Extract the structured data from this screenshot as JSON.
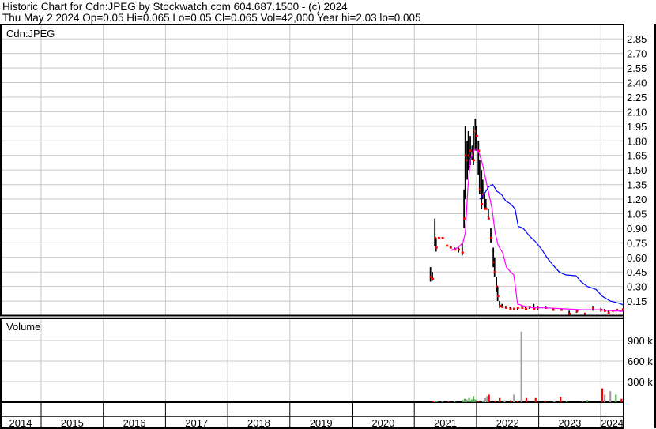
{
  "header": {
    "title": "Historic Chart for Cdn:JPEG by Stockwatch.com 604.687.1500 - (c) 2024",
    "quote": "Thu May  2 2024   Op=0.05   Hi=0.065   Lo=0.05   Cl=0.065   Vol=42,000   Year hi=2.03   lo=0.005"
  },
  "chart_data": [
    {
      "type": "line",
      "title": "Cdn:JPEG",
      "subtype": "ohlc-with-moving-averages",
      "ylim": [
        0,
        2.95
      ],
      "yticks": [
        "2.85",
        "2.70",
        "2.55",
        "2.40",
        "2.25",
        "2.10",
        "1.95",
        "1.80",
        "1.65",
        "1.50",
        "1.35",
        "1.20",
        "1.05",
        "0.90",
        "0.75",
        "0.60",
        "0.45",
        "0.30",
        "0.15"
      ],
      "xlim": [
        2014.34,
        2024.38
      ],
      "xtick_labels": [
        "2014",
        "2015",
        "2016",
        "2017",
        "2018",
        "2019",
        "2020",
        "2021",
        "2022",
        "2023",
        "2024"
      ],
      "colors": {
        "bar": "#000000",
        "close": "#ff0000",
        "ma_short": "#ff00ff",
        "ma_long": "#0000ff"
      },
      "bars_t_hi_lo_close": [
        [
          2021.26,
          0.5,
          0.35,
          0.4
        ],
        [
          2021.29,
          0.45,
          0.36,
          0.38
        ],
        [
          2021.33,
          1.0,
          0.72,
          0.8
        ],
        [
          2021.35,
          0.8,
          0.66,
          0.7
        ],
        [
          2021.39,
          0.8,
          0.8,
          0.8
        ],
        [
          2021.45,
          0.8,
          0.8,
          0.8
        ],
        [
          2021.52,
          0.73,
          0.72,
          0.72
        ],
        [
          2021.58,
          0.72,
          0.7,
          0.7
        ],
        [
          2021.65,
          0.7,
          0.68,
          0.68
        ],
        [
          2021.71,
          0.7,
          0.65,
          0.68
        ],
        [
          2021.77,
          0.75,
          0.62,
          0.65
        ],
        [
          2021.8,
          1.3,
          0.9,
          1.0
        ],
        [
          2021.82,
          1.95,
          1.2,
          1.65
        ],
        [
          2021.85,
          1.8,
          1.4,
          1.6
        ],
        [
          2021.87,
          1.9,
          1.5,
          1.65
        ],
        [
          2021.9,
          1.85,
          1.55,
          1.7
        ],
        [
          2021.93,
          1.75,
          1.6,
          1.65
        ],
        [
          2021.95,
          1.95,
          1.55,
          1.6
        ],
        [
          2021.98,
          2.03,
          1.7,
          1.9
        ],
        [
          2022.0,
          1.95,
          1.7,
          1.85
        ],
        [
          2022.03,
          1.8,
          1.45,
          1.7
        ],
        [
          2022.05,
          1.6,
          1.25,
          1.3
        ],
        [
          2022.08,
          1.5,
          1.1,
          1.15
        ],
        [
          2022.1,
          1.4,
          1.2,
          1.25
        ],
        [
          2022.13,
          1.25,
          1.1,
          1.1
        ],
        [
          2022.15,
          1.2,
          1.1,
          1.1
        ],
        [
          2022.19,
          1.1,
          1.0,
          1.0
        ],
        [
          2022.23,
          0.9,
          0.75,
          0.8
        ],
        [
          2022.27,
          0.7,
          0.5,
          0.55
        ],
        [
          2022.29,
          0.6,
          0.4,
          0.45
        ],
        [
          2022.32,
          0.4,
          0.25,
          0.3
        ],
        [
          2022.34,
          0.3,
          0.15,
          0.2
        ],
        [
          2022.37,
          0.15,
          0.08,
          0.1
        ],
        [
          2022.41,
          0.12,
          0.08,
          0.09
        ],
        [
          2022.47,
          0.1,
          0.07,
          0.08
        ],
        [
          2022.54,
          0.09,
          0.06,
          0.07
        ],
        [
          2022.6,
          0.08,
          0.06,
          0.07
        ],
        [
          2022.66,
          0.09,
          0.06,
          0.08
        ],
        [
          2022.73,
          0.1,
          0.07,
          0.08
        ],
        [
          2022.79,
          0.09,
          0.06,
          0.07
        ],
        [
          2022.85,
          0.1,
          0.07,
          0.09
        ],
        [
          2022.92,
          0.12,
          0.06,
          0.07
        ],
        [
          2022.98,
          0.1,
          0.06,
          0.08
        ],
        [
          2023.11,
          0.1,
          0.07,
          0.08
        ],
        [
          2023.23,
          0.08,
          0.05,
          0.06
        ],
        [
          2023.36,
          0.07,
          0.05,
          0.06
        ],
        [
          2023.49,
          0.05,
          0.01,
          0.02
        ],
        [
          2023.61,
          0.06,
          0.03,
          0.05
        ],
        [
          2023.74,
          0.03,
          0.005,
          0.02
        ],
        [
          2023.87,
          0.1,
          0.05,
          0.08
        ],
        [
          2024.0,
          0.08,
          0.04,
          0.06
        ],
        [
          2024.06,
          0.07,
          0.04,
          0.05
        ],
        [
          2024.12,
          0.06,
          0.02,
          0.03
        ],
        [
          2024.19,
          0.06,
          0.04,
          0.05
        ],
        [
          2024.25,
          0.07,
          0.05,
          0.06
        ],
        [
          2024.31,
          0.06,
          0.04,
          0.05
        ],
        [
          2024.35,
          0.065,
          0.05,
          0.065
        ]
      ],
      "ma_short_t_v": [
        [
          2021.58,
          0.67
        ],
        [
          2021.7,
          0.7
        ],
        [
          2021.78,
          0.75
        ],
        [
          2021.82,
          0.85
        ],
        [
          2021.86,
          1.3
        ],
        [
          2021.9,
          1.6
        ],
        [
          2021.95,
          1.7
        ],
        [
          2022.0,
          1.72
        ],
        [
          2022.05,
          1.66
        ],
        [
          2022.1,
          1.55
        ],
        [
          2022.15,
          1.4
        ],
        [
          2022.2,
          1.25
        ],
        [
          2022.25,
          1.1
        ],
        [
          2022.3,
          0.85
        ],
        [
          2022.35,
          0.72
        ],
        [
          2022.42,
          0.65
        ],
        [
          2022.48,
          0.5
        ],
        [
          2022.55,
          0.45
        ],
        [
          2022.6,
          0.42
        ],
        [
          2022.66,
          0.12
        ],
        [
          2022.75,
          0.1
        ],
        [
          2022.9,
          0.08
        ],
        [
          2023.1,
          0.08
        ],
        [
          2023.4,
          0.07
        ],
        [
          2023.7,
          0.06
        ],
        [
          2024.0,
          0.06
        ],
        [
          2024.2,
          0.05
        ],
        [
          2024.36,
          0.045
        ]
      ],
      "ma_long_t_v": [
        [
          2022.05,
          1.2
        ],
        [
          2022.12,
          1.25
        ],
        [
          2022.2,
          1.33
        ],
        [
          2022.26,
          1.35
        ],
        [
          2022.33,
          1.28
        ],
        [
          2022.4,
          1.25
        ],
        [
          2022.47,
          1.18
        ],
        [
          2022.55,
          1.15
        ],
        [
          2022.62,
          1.1
        ],
        [
          2022.67,
          0.92
        ],
        [
          2022.75,
          0.9
        ],
        [
          2022.85,
          0.82
        ],
        [
          2022.95,
          0.76
        ],
        [
          2023.05,
          0.68
        ],
        [
          2023.13,
          0.6
        ],
        [
          2023.23,
          0.52
        ],
        [
          2023.33,
          0.45
        ],
        [
          2023.43,
          0.42
        ],
        [
          2023.6,
          0.41
        ],
        [
          2023.68,
          0.35
        ],
        [
          2023.78,
          0.3
        ],
        [
          2023.92,
          0.27
        ],
        [
          2024.02,
          0.2
        ],
        [
          2024.15,
          0.15
        ],
        [
          2024.28,
          0.13
        ],
        [
          2024.36,
          0.11
        ]
      ]
    },
    {
      "type": "bar",
      "title": "Volume",
      "ylim": [
        0,
        1100
      ],
      "yunit": "k",
      "yticks": [
        "900 k",
        "600 k",
        "300 k"
      ],
      "colors": {
        "up": "#4caf50",
        "down": "#ff0000",
        "flat": "#a0a0a0"
      },
      "bars_t_volk_dir": [
        [
          2021.3,
          20,
          "down"
        ],
        [
          2021.33,
          15,
          "flat"
        ],
        [
          2021.36,
          20,
          "up"
        ],
        [
          2021.45,
          10,
          "flat"
        ],
        [
          2021.55,
          10,
          "down"
        ],
        [
          2021.65,
          10,
          "flat"
        ],
        [
          2021.78,
          30,
          "up"
        ],
        [
          2021.81,
          50,
          "up"
        ],
        [
          2021.84,
          40,
          "flat"
        ],
        [
          2021.88,
          60,
          "up"
        ],
        [
          2021.92,
          40,
          "up"
        ],
        [
          2021.95,
          90,
          "up"
        ],
        [
          2021.98,
          40,
          "up"
        ],
        [
          2022.03,
          15,
          "down"
        ],
        [
          2022.1,
          20,
          "up"
        ],
        [
          2022.14,
          60,
          "flat"
        ],
        [
          2022.17,
          90,
          "flat"
        ],
        [
          2022.2,
          110,
          "down"
        ],
        [
          2022.3,
          20,
          "down"
        ],
        [
          2022.37,
          60,
          "down"
        ],
        [
          2022.45,
          30,
          "flat"
        ],
        [
          2022.55,
          30,
          "down"
        ],
        [
          2022.6,
          110,
          "flat"
        ],
        [
          2022.66,
          20,
          "down"
        ],
        [
          2022.72,
          1030,
          "flat"
        ],
        [
          2022.8,
          60,
          "down"
        ],
        [
          2022.95,
          60,
          "down"
        ],
        [
          2023.1,
          20,
          "down"
        ],
        [
          2023.25,
          20,
          "flat"
        ],
        [
          2023.35,
          80,
          "down"
        ],
        [
          2023.45,
          20,
          "up"
        ],
        [
          2023.7,
          10,
          "flat"
        ],
        [
          2023.78,
          30,
          "up"
        ],
        [
          2024.02,
          200,
          "down"
        ],
        [
          2024.06,
          110,
          "flat"
        ],
        [
          2024.15,
          160,
          "flat"
        ],
        [
          2024.24,
          110,
          "up"
        ],
        [
          2024.33,
          50,
          "down"
        ]
      ]
    }
  ]
}
